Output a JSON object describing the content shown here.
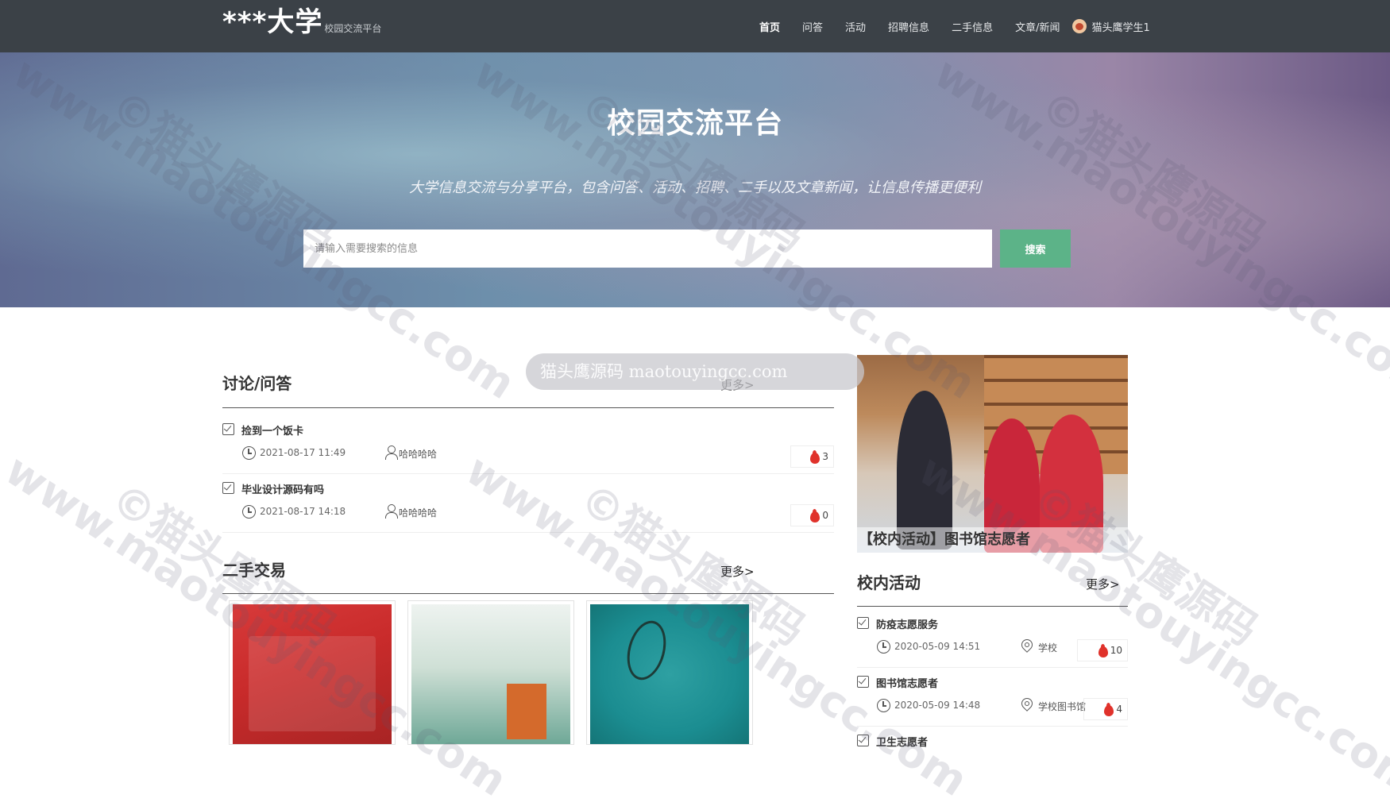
{
  "header": {
    "logo_main": "***大学",
    "logo_sub": "校园交流平台",
    "nav": [
      {
        "label": "首页",
        "active": true
      },
      {
        "label": "问答"
      },
      {
        "label": "活动"
      },
      {
        "label": "招聘信息"
      },
      {
        "label": "二手信息"
      },
      {
        "label": "文章/新闻"
      }
    ],
    "user_name": "猫头鹰学生1"
  },
  "hero": {
    "title": "校园交流平台",
    "subtitle": "大学信息交流与分享平台，包含问答、活动、招聘、二手以及文章新闻，让信息传播更便利",
    "search_placeholder": "请输入需要搜索的信息",
    "search_button": "搜索"
  },
  "qa": {
    "title": "讨论/问答",
    "more": "更多>",
    "items": [
      {
        "title": "捡到一个饭卡",
        "date": "2021-08-17 11:49",
        "author": "哈哈哈哈",
        "hot": "3"
      },
      {
        "title": "毕业设计源码有吗",
        "date": "2021-08-17 14:18",
        "author": "哈哈哈哈",
        "hot": "0"
      }
    ]
  },
  "second_hand": {
    "title": "二手交易",
    "more": "更多>"
  },
  "featured": {
    "caption": "【校内活动】图书馆志愿者"
  },
  "activities": {
    "title": "校内活动",
    "more": "更多>",
    "items": [
      {
        "title": "防疫志愿服务",
        "date": "2020-05-09 14:51",
        "location": "学校",
        "hot": "10"
      },
      {
        "title": "图书馆志愿者",
        "date": "2020-05-09 14:48",
        "location": "学校图书馆",
        "hot": "4"
      },
      {
        "title": "卫生志愿者"
      }
    ]
  },
  "watermark": {
    "url": "www.maotouyingcc.com",
    "brand": "©猫头鹰源码",
    "pill": "猫头鹰源码 maotouyingcc.com"
  },
  "colors": {
    "topbar": "#3b4147",
    "search_button": "#5cb388",
    "hot_flame": "#e0322b"
  }
}
